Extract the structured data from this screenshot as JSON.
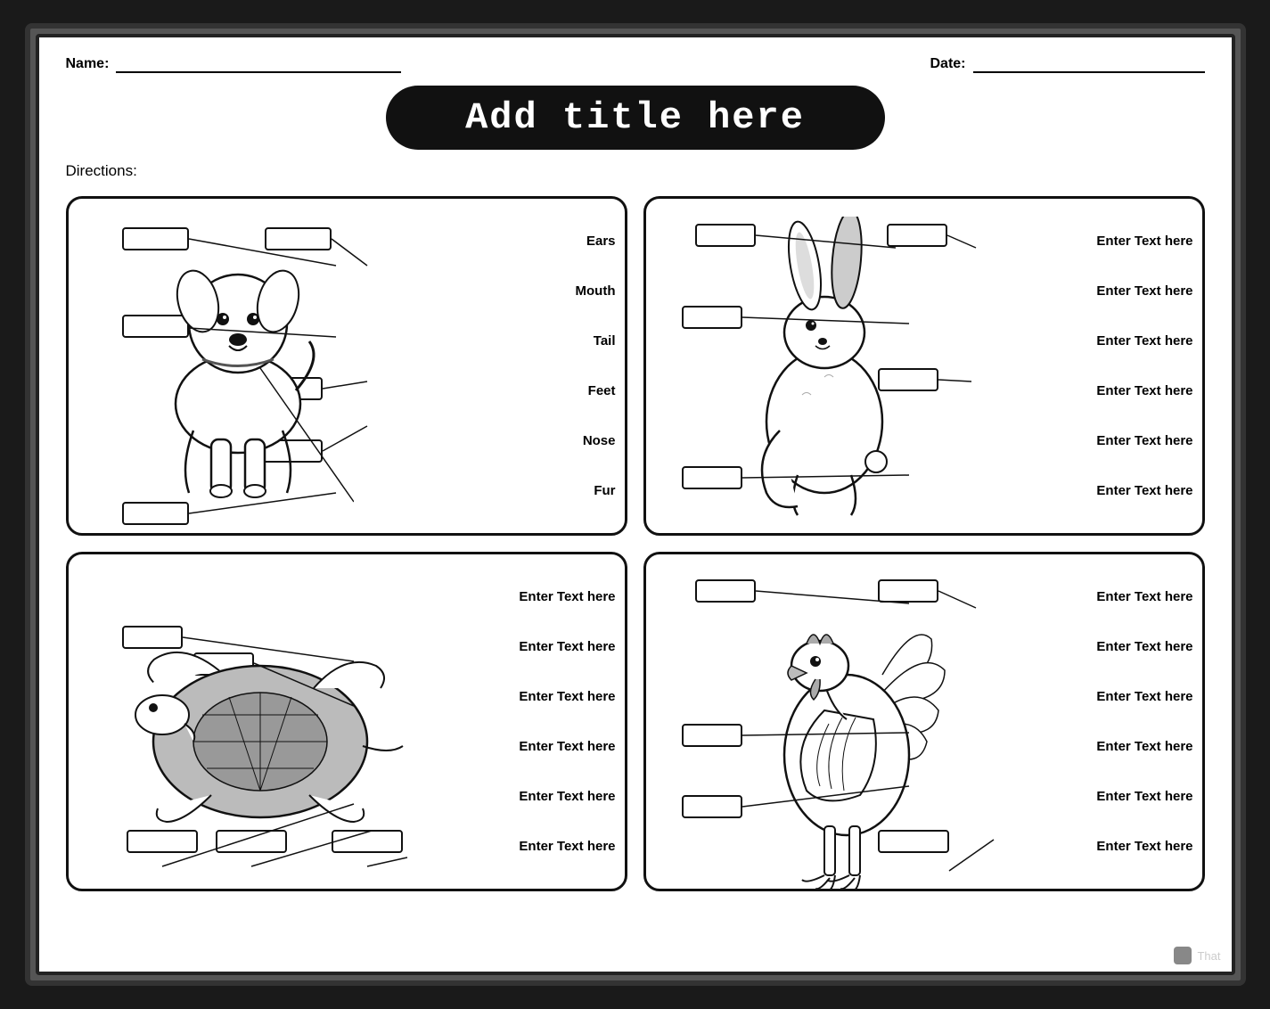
{
  "header": {
    "name_label": "Name:",
    "date_label": "Date:"
  },
  "title": "Add title here",
  "directions": "Directions:",
  "quadrants": [
    {
      "id": "dog",
      "labels_right": [
        "Ears",
        "Mouth",
        "Tail",
        "Feet",
        "Nose",
        "Fur"
      ]
    },
    {
      "id": "rabbit",
      "labels_right": [
        "Enter Text here",
        "Enter Text here",
        "Enter Text here",
        "Enter Text here",
        "Enter Text here",
        "Enter Text here"
      ]
    },
    {
      "id": "turtle",
      "labels_right": [
        "Enter Text here",
        "Enter Text here",
        "Enter Text here",
        "Enter Text here",
        "Enter Text here",
        "Enter Text here"
      ]
    },
    {
      "id": "rooster",
      "labels_right": [
        "Enter Text here",
        "Enter Text here",
        "Enter Text here",
        "Enter Text here",
        "Enter Text here",
        "Enter Text here"
      ]
    }
  ],
  "bottom": {
    "app_name": "That"
  }
}
